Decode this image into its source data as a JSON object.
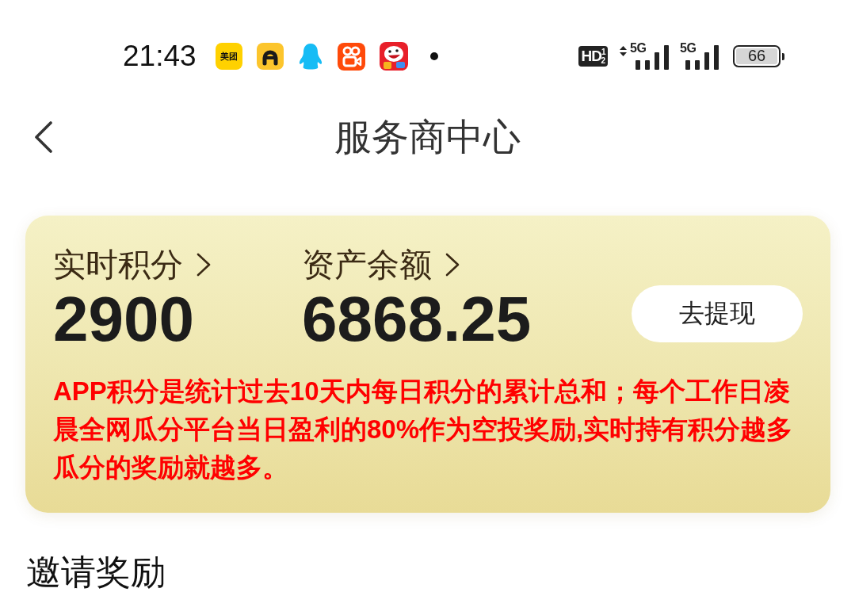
{
  "status_bar": {
    "time": "21:43",
    "notification_icons": [
      {
        "kind": "text_tile",
        "label": "美团"
      },
      {
        "kind": "arch"
      },
      {
        "kind": "penguin"
      },
      {
        "kind": "video"
      },
      {
        "kind": "mascot"
      },
      {
        "kind": "dot"
      }
    ],
    "hd_indicator": "HD$^{1}$$_{2}$",
    "signals": [
      {
        "label": "5G",
        "arrows": true
      },
      {
        "label": "5G",
        "arrows": false
      }
    ],
    "battery": "66"
  },
  "header": {
    "title": "服务商中心"
  },
  "summary_card": {
    "stats": [
      {
        "label": "实时积分",
        "value": "2900"
      },
      {
        "label": "资产余额",
        "value": "6868.25"
      }
    ],
    "withdraw_button": "去提现",
    "notice": "APP积分是统计过去10天内每日积分的累计总和；每个工作日凌晨全网瓜分平台当日盈利的80%作为空投奖励,实时持有积分越多瓜分的奖励就越多。"
  },
  "section": {
    "title": "邀请奖励"
  }
}
